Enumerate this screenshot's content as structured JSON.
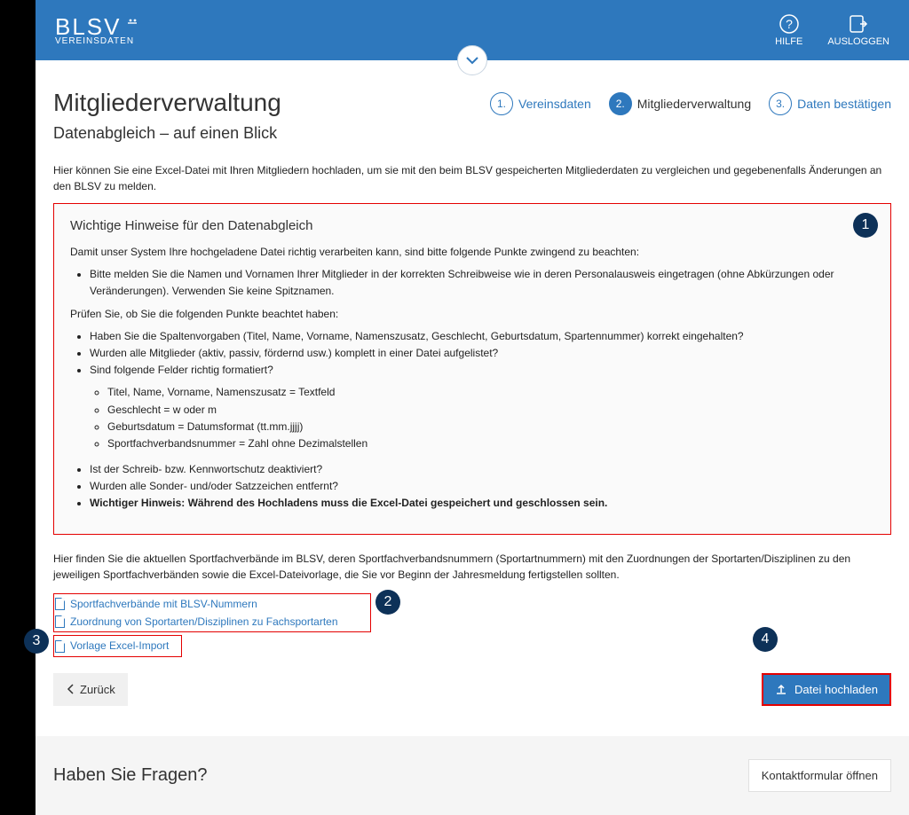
{
  "header": {
    "brand": "BLSV",
    "brand_sub": "VEREINSDATEN",
    "help": "HILFE",
    "logout": "AUSLOGGEN"
  },
  "stepper": {
    "s1": {
      "num": "1.",
      "label": "Vereinsdaten"
    },
    "s2": {
      "num": "2.",
      "label": "Mitgliederverwaltung"
    },
    "s3": {
      "num": "3.",
      "label": "Daten bestätigen"
    }
  },
  "title": "Mitgliederverwaltung",
  "subtitle": "Datenabgleich – auf einen Blick",
  "intro": "Hier können Sie eine Excel-Datei mit Ihren Mitgliedern hochladen, um sie mit den beim BLSV gespeicherten Mitgliederdaten zu vergleichen und gegebenenfalls Änderungen an den BLSV zu melden.",
  "info": {
    "heading": "Wichtige Hinweise für den Datenabgleich",
    "p1": "Damit unser System Ihre hochgeladene Datei richtig verarbeiten kann, sind bitte folgende Punkte zwingend zu beachten:",
    "b1": "Bitte melden Sie die Namen und Vornamen Ihrer Mitglieder in der korrekten Schreibweise wie in deren Personalausweis eingetragen (ohne Abkürzungen oder Veränderungen). Verwenden Sie keine Spitznamen.",
    "p2": "Prüfen Sie, ob Sie die folgenden Punkte beachtet haben:",
    "c1": "Haben Sie die Spaltenvorgaben (Titel, Name, Vorname, Namenszusatz, Geschlecht, Geburtsdatum, Spartennummer) korrekt eingehalten?",
    "c2": "Wurden alle Mitglieder (aktiv, passiv, fördernd usw.) komplett in einer Datei aufgelistet?",
    "c3": "Sind folgende Felder richtig formatiert?",
    "c3a": "Titel, Name, Vorname, Namenszusatz = Textfeld",
    "c3b": "Geschlecht = w oder m",
    "c3c": "Geburtsdatum = Datumsformat (tt.mm.jjjj)",
    "c3d": "Sportfachverbandsnummer = Zahl ohne Dezimalstellen",
    "c4": "Ist der Schreib- bzw. Kennwortschutz deaktiviert?",
    "c5": "Wurden alle Sonder- und/oder Satzzeichen entfernt?",
    "c6": "Wichtiger Hinweis: Während des Hochladens muss die Excel-Datei gespeichert und geschlossen sein."
  },
  "below": "Hier finden Sie die aktuellen Sportfachverbände im BLSV, deren Sportfachverbandsnummern (Sportartnummern) mit den Zuordnungen der Sportarten/Disziplinen zu den jeweiligen Sportfachverbänden sowie die Excel-Dateivorlage, die Sie vor Beginn der Jahresmeldung fertigstellen sollten.",
  "links": {
    "l1": "Sportfachverbände mit BLSV-Nummern",
    "l2": "Zuordnung von Sportarten/Disziplinen zu Fachsportarten",
    "l3": "Vorlage Excel-Import"
  },
  "buttons": {
    "back": "Zurück",
    "upload": "Datei hochladen"
  },
  "footer": {
    "question": "Haben Sie Fragen?",
    "contact": "Kontaktformular öffnen"
  },
  "callouts": {
    "c1": "1",
    "c2": "2",
    "c3": "3",
    "c4": "4"
  }
}
